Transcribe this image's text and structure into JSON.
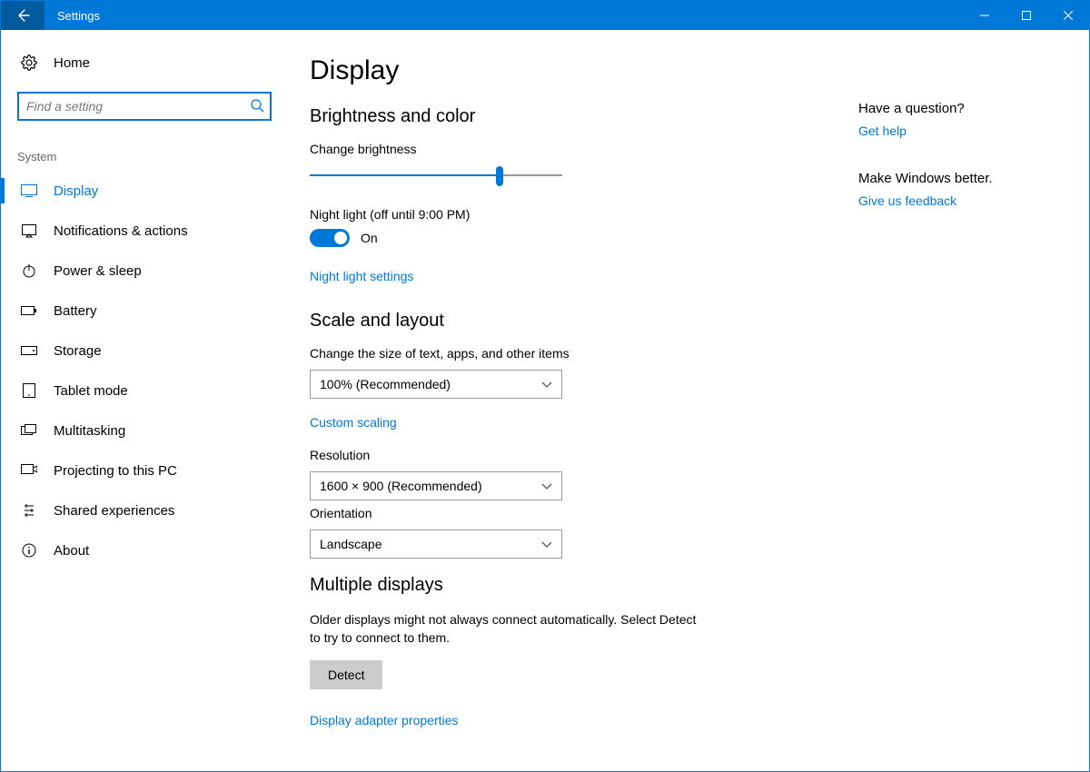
{
  "titlebar": {
    "title": "Settings"
  },
  "sidebar": {
    "home_label": "Home",
    "search_placeholder": "Find a setting",
    "category": "System",
    "items": [
      {
        "label": "Display"
      },
      {
        "label": "Notifications & actions"
      },
      {
        "label": "Power & sleep"
      },
      {
        "label": "Battery"
      },
      {
        "label": "Storage"
      },
      {
        "label": "Tablet mode"
      },
      {
        "label": "Multitasking"
      },
      {
        "label": "Projecting to this PC"
      },
      {
        "label": "Shared experiences"
      },
      {
        "label": "About"
      }
    ]
  },
  "main": {
    "page_title": "Display",
    "brightness": {
      "heading": "Brightness and color",
      "change_label": "Change brightness",
      "slider_pct": 75,
      "night_light_label": "Night light (off until 9:00 PM)",
      "night_light_state": "On",
      "night_light_settings": "Night light settings"
    },
    "scale": {
      "heading": "Scale and layout",
      "size_label": "Change the size of text, apps, and other items",
      "size_value": "100% (Recommended)",
      "custom_scaling": "Custom scaling",
      "resolution_label": "Resolution",
      "resolution_value": "1600 × 900 (Recommended)",
      "orientation_label": "Orientation",
      "orientation_value": "Landscape"
    },
    "multi": {
      "heading": "Multiple displays",
      "text": "Older displays might not always connect automatically. Select Detect to try to connect to them.",
      "detect": "Detect",
      "adapter_link": "Display adapter properties"
    }
  },
  "aside": {
    "question": "Have a question?",
    "get_help": "Get help",
    "better": "Make Windows better.",
    "feedback": "Give us feedback"
  }
}
